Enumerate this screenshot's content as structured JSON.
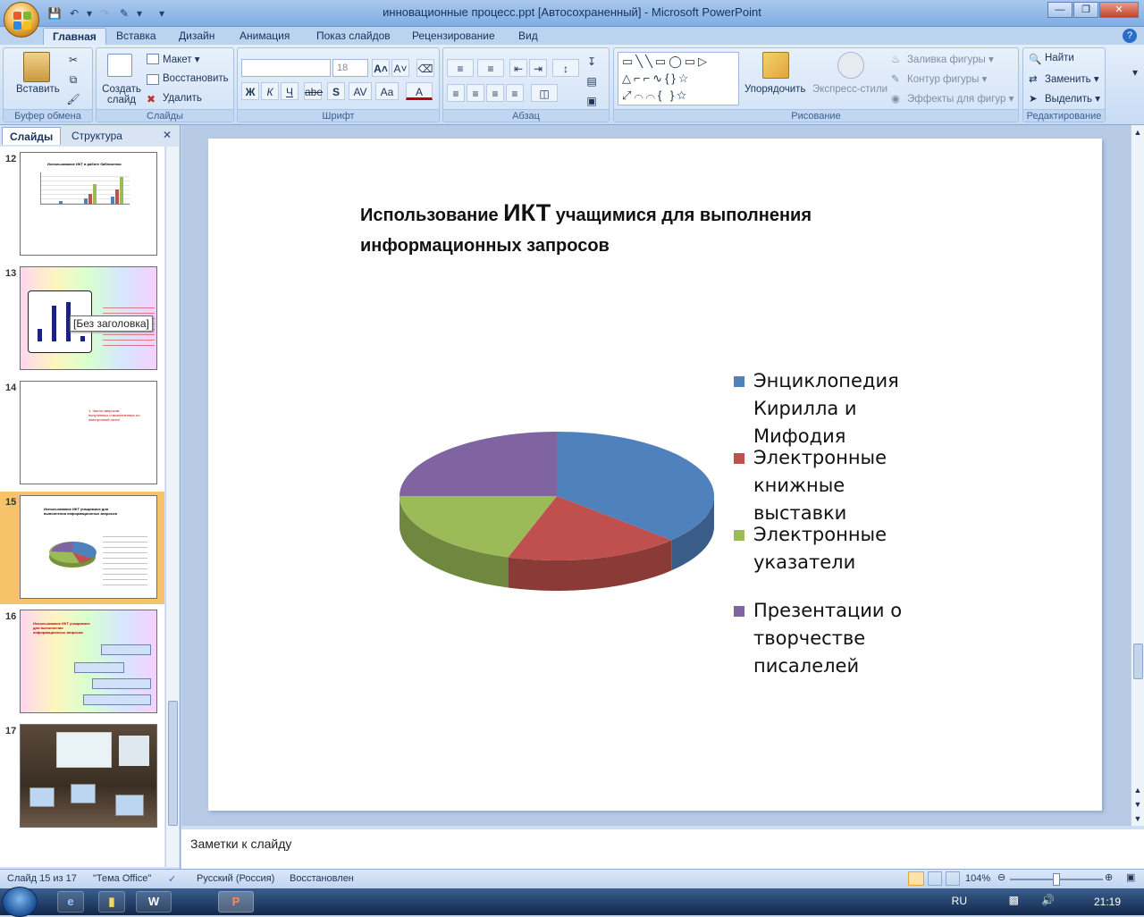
{
  "window": {
    "title": "инновационные процесс.ppt [Автосохраненный] - Microsoft PowerPoint"
  },
  "qat": {
    "save_icon": "save-icon",
    "undo_icon": "undo-icon",
    "redo_icon": "redo-icon"
  },
  "tabs": [
    "Главная",
    "Вставка",
    "Дизайн",
    "Анимация",
    "Показ слайдов",
    "Рецензирование",
    "Вид"
  ],
  "ribbon": {
    "clipboard": {
      "label": "Буфер обмена",
      "paste": "Вставить"
    },
    "slides": {
      "label": "Слайды",
      "create": "Создать слайд",
      "layout": "Макет",
      "reset": "Восстановить",
      "delete": "Удалить"
    },
    "font": {
      "label": "Шрифт",
      "size": "18",
      "bold": "Ж",
      "italic": "К",
      "underline": "Ч",
      "strike": "abe",
      "shadow": "S",
      "spacing": "AV",
      "case": "Aa",
      "color": "A"
    },
    "paragraph": {
      "label": "Абзац"
    },
    "drawing": {
      "label": "Рисование",
      "arrange": "Упорядочить",
      "quickstyles": "Экспресс-стили",
      "fill": "Заливка фигуры",
      "outline": "Контур фигуры",
      "effects": "Эффекты для фигур"
    },
    "editing": {
      "label": "Редактирование",
      "find": "Найти",
      "replace": "Заменить",
      "select": "Выделить"
    }
  },
  "panel": {
    "tab_slides": "Слайды",
    "tab_outline": "Структура",
    "tooltip": "[Без заголовка]",
    "thumbs": [
      {
        "num": "12",
        "title": "Использование ИКТ в работе библиотеки"
      },
      {
        "num": "13",
        "title": ""
      },
      {
        "num": "14",
        "title": "1. Число запросов, полученных и выполненных по электронной почте"
      },
      {
        "num": "15",
        "title": "Использование ИКТ учащимися для выполнения информационных запросов"
      },
      {
        "num": "16",
        "title": "Использование ИКТ учащимися для выполнения информационных запросов"
      },
      {
        "num": "17",
        "title": ""
      }
    ]
  },
  "slide": {
    "title_pre": "Использование ",
    "title_big": "ИКТ",
    "title_post": " учащимися для выполнения",
    "title_line2": " информационных запросов"
  },
  "chart_data": {
    "type": "pie",
    "title": "",
    "series": [
      {
        "name": "Энциклопедия Кирилла и Мифодия",
        "value": 37,
        "color": "#4f81bd"
      },
      {
        "name": "Электронные книжные выставки",
        "value": 18,
        "color": "#c0504d"
      },
      {
        "name": "Электронные указатели",
        "value": 20,
        "color": "#9bbb59"
      },
      {
        "name": "Презентации о творчестве писалелей",
        "value": 25,
        "color": "#8064a2"
      }
    ],
    "legend": {
      "position": "right",
      "lines": [
        [
          "Энциклопедия",
          "Кирилла и",
          "Мифодия"
        ],
        [
          "Электронные",
          "книжные",
          "выставки"
        ],
        [
          "Электронные",
          "указатели"
        ],
        [
          "Презентации о",
          "творчестве",
          "писалелей"
        ]
      ]
    }
  },
  "notes": {
    "placeholder": "Заметки к слайду"
  },
  "status": {
    "slide": "Слайд 15 из 17",
    "theme": "\"Тема Office\"",
    "lang": "Русский (Россия)",
    "state": "Восстановлен",
    "zoom": "104%"
  },
  "taskbar": {
    "lang": "RU",
    "time": "21:19"
  }
}
